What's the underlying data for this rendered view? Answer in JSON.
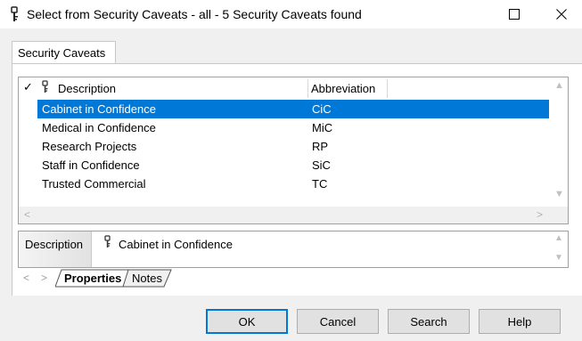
{
  "window": {
    "title": "Select from Security Caveats - all - 5 Security Caveats found",
    "icons": {
      "title": "key-icon",
      "maximize": "maximize-icon",
      "close": "close-icon"
    }
  },
  "tab": {
    "label": "Security Caveats"
  },
  "grid": {
    "check_header": "✓",
    "columns": [
      "Description",
      "Abbreviation"
    ],
    "rows": [
      {
        "description": "Cabinet in Confidence",
        "abbreviation": "CiC",
        "selected": true
      },
      {
        "description": "Medical in Confidence",
        "abbreviation": "MiC",
        "selected": false
      },
      {
        "description": "Research Projects",
        "abbreviation": "RP",
        "selected": false
      },
      {
        "description": "Staff in Confidence",
        "abbreviation": "SiC",
        "selected": false
      },
      {
        "description": "Trusted Commercial",
        "abbreviation": "TC",
        "selected": false
      }
    ],
    "selection_color": "#0078d7"
  },
  "properties": {
    "label": "Description",
    "value": "Cabinet in Confidence"
  },
  "bottom_tabs": {
    "properties": "Properties",
    "notes": "Notes",
    "prev": "<",
    "next": ">"
  },
  "buttons": {
    "ok": "OK",
    "cancel": "Cancel",
    "search": "Search",
    "help": "Help"
  }
}
